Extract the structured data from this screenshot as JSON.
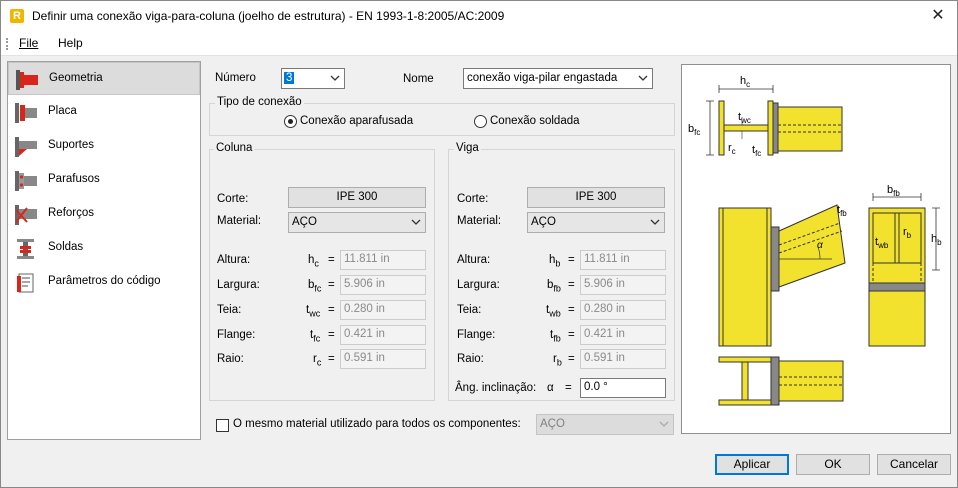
{
  "window": {
    "title": "Definir uma conexão viga-para-coluna (joelho de estrutura) - EN 1993-1-8:2005/AC:2009",
    "app_icon": "R",
    "close_icon": "✕"
  },
  "menu": {
    "file": "File",
    "help": "Help"
  },
  "sidebar": {
    "items": [
      {
        "label": "Geometria",
        "icon": "geometry-icon",
        "selected": true
      },
      {
        "label": "Placa",
        "icon": "plate-icon"
      },
      {
        "label": "Suportes",
        "icon": "supports-icon"
      },
      {
        "label": "Parafusos",
        "icon": "bolts-icon"
      },
      {
        "label": "Reforços",
        "icon": "stiffeners-icon"
      },
      {
        "label": "Soldas",
        "icon": "welds-icon"
      },
      {
        "label": "Parâmetros do código",
        "icon": "code-parameters-icon"
      }
    ]
  },
  "header": {
    "numero_label": "Número",
    "numero_value": "3",
    "nome_label": "Nome",
    "nome_value": "conexão viga-pilar engastada"
  },
  "connection_type": {
    "title": "Tipo de conexão",
    "bolted": "Conexão aparafusada",
    "welded": "Conexão soldada",
    "selected": "bolted"
  },
  "column": {
    "title": "Coluna",
    "corte_label": "Corte:",
    "section": "IPE 300",
    "material_label": "Material:",
    "material": "AÇO",
    "rows": [
      {
        "label": "Altura:",
        "sym": "h",
        "sub": "c",
        "value": "11.811 in"
      },
      {
        "label": "Largura:",
        "sym": "b",
        "sub": "fc",
        "value": "5.906 in"
      },
      {
        "label": "Teia:",
        "sym": "t",
        "sub": "wc",
        "value": "0.280 in"
      },
      {
        "label": "Flange:",
        "sym": "t",
        "sub": "fc",
        "value": "0.421 in"
      },
      {
        "label": "Raio:",
        "sym": "r",
        "sub": "c",
        "value": "0.591 in"
      }
    ]
  },
  "beam": {
    "title": "Viga",
    "corte_label": "Corte:",
    "section": "IPE 300",
    "material_label": "Material:",
    "material": "AÇO",
    "rows": [
      {
        "label": "Altura:",
        "sym": "h",
        "sub": "b",
        "value": "11.811 in"
      },
      {
        "label": "Largura:",
        "sym": "b",
        "sub": "fb",
        "value": "5.906 in"
      },
      {
        "label": "Teia:",
        "sym": "t",
        "sub": "wb",
        "value": "0.280 in"
      },
      {
        "label": "Flange:",
        "sym": "t",
        "sub": "fb",
        "value": "0.421 in"
      },
      {
        "label": "Raio:",
        "sym": "r",
        "sub": "b",
        "value": "0.591 in"
      }
    ],
    "angle_label": "Âng. inclinação:",
    "angle_sym": "α",
    "angle_value": "0.0 °"
  },
  "same_material": {
    "label": "O mesmo material utilizado para todos os componentes:",
    "value": "AÇO",
    "checked": false
  },
  "diagram_labels": {
    "hc": "h",
    "hc_sub": "c",
    "bfc": "b",
    "bfc_sub": "fc",
    "twc": "t",
    "twc_sub": "wc",
    "rc": "r",
    "rc_sub": "c",
    "tfc": "t",
    "tfc_sub": "fc",
    "alpha": "α",
    "bfb": "b",
    "bfb_sub": "fb",
    "tfb": "t",
    "tfb_sub": "fb",
    "twb": "t",
    "twb_sub": "wb",
    "rb": "r",
    "rb_sub": "b",
    "hb": "h",
    "hb_sub": "b"
  },
  "buttons": {
    "apply": "Aplicar",
    "ok": "OK",
    "cancel": "Cancelar"
  },
  "colors": {
    "steel": "#f2e22e",
    "steel_stroke": "#333333",
    "accent": "#0078d7",
    "icon_red": "#d9261c"
  }
}
